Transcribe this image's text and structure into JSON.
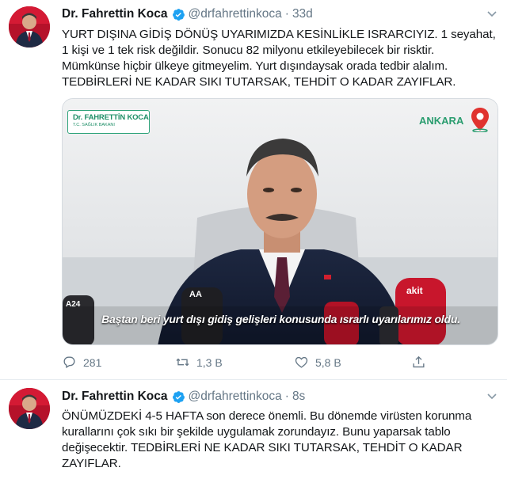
{
  "tweets": [
    {
      "author_name": "Dr. Fahrettin Koca",
      "handle": "@drfahrettinkoca",
      "separator": "·",
      "time": "33d",
      "text_lines": [
        "YURT DIŞINA GİDİŞ DÖNÜŞ UYARIMIZDA KESİNLİKLE ISRARCIYIZ. 1 seyahat,",
        "1 kişi ve 1 tek risk değildir. Sonucu 82 milyonu etkileyebilecek bir risktir.",
        "Mümkünse hiçbir ülkeye gitmeyelim. Yurt dışındaysak orada tedbir alalım.",
        "TEDBİRLERİ NE KADAR SIKI TUTARSAK, TEHDİT O KADAR ZAYIFLAR."
      ],
      "media": {
        "ministry_badge": "Dr. FAHRETTİN KOCA",
        "ministry_sub": "T.C. SAĞLIK BAKANI",
        "city": "ANKARA",
        "subtitle": "Baştan beri yurt dışı gidiş gelişleri konusunda ısrarlı uyarılarımız oldu.",
        "mic_labels": [
          "A24",
          "AA",
          "akit"
        ]
      },
      "replies": "281",
      "retweets": "1,3 B",
      "likes": "5,8 B"
    },
    {
      "author_name": "Dr. Fahrettin Koca",
      "handle": "@drfahrettinkoca",
      "separator": "·",
      "time": "8s",
      "text_lines": [
        "ÖNÜMÜZDEKİ 4-5 HAFTA son derece önemli. Bu dönemde virüsten korunma",
        "kurallarını çok sıkı bir şekilde uygulamak zorundayız. Bunu yaparsak tablo",
        "değişecektir. TEDBİRLERİ NE KADAR SIKI TUTARSAK, TEHDİT O KADAR",
        "ZAYIFLAR."
      ]
    }
  ],
  "colors": {
    "text": "#14171a",
    "muted": "#657786",
    "verified": "#1da1f2",
    "divider": "#e6ecf0",
    "badge_green": "#1f8f68"
  },
  "icons": [
    "verified-icon",
    "chevron-down-icon",
    "reply-icon",
    "retweet-icon",
    "like-icon",
    "share-icon",
    "location-pin-icon"
  ]
}
